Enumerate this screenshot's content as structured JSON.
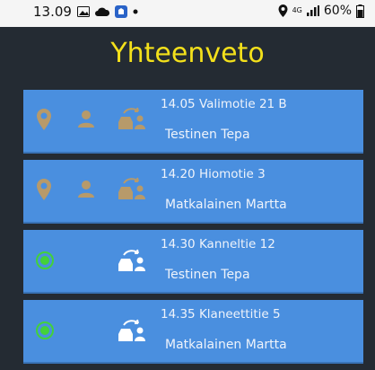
{
  "status_bar": {
    "time": "13.09",
    "network": "4G",
    "battery": "60%",
    "icons": [
      "image-icon",
      "cloud-icon",
      "app-icon",
      "dot-icon",
      "location-icon",
      "signal-icon",
      "battery-icon"
    ]
  },
  "header": {
    "title": "Yhteenveto"
  },
  "colors": {
    "background": "#242b33",
    "card": "#4a8fdf",
    "title": "#f3e01b",
    "active_dot": "#43d13a",
    "inactive_icon": "#b79a6a"
  },
  "rides": [
    {
      "time_address": "14.05 Valimotie 21 B",
      "name": "Testinen Tepa",
      "state": "inactive"
    },
    {
      "time_address": "14.20 Hiomotie 3",
      "name": "Matkalainen Martta",
      "state": "inactive"
    },
    {
      "time_address": "14.30 Kanneltie 12",
      "name": "Testinen Tepa",
      "state": "active"
    },
    {
      "time_address": "14.35 Klaneettitie 5",
      "name": "Matkalainen Martta",
      "state": "active"
    }
  ]
}
